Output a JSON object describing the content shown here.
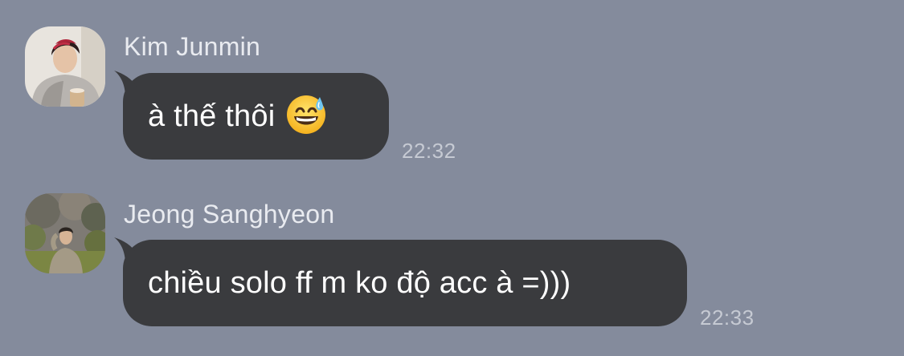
{
  "chat": {
    "messages": [
      {
        "sender": "Kim Junmin",
        "text": "à thế thôi",
        "emoji": "grinning-face-with-sweat",
        "time": "22:32"
      },
      {
        "sender": "Jeong Sanghyeon",
        "text": "chiều solo ff m ko độ acc à =)))",
        "time": "22:33"
      }
    ]
  },
  "colors": {
    "background": "#848b9c",
    "bubble": "#3a3b3e",
    "bubble_text": "#ffffff",
    "sender_text": "#e9ebf0",
    "timestamp": "#c6cad3"
  }
}
